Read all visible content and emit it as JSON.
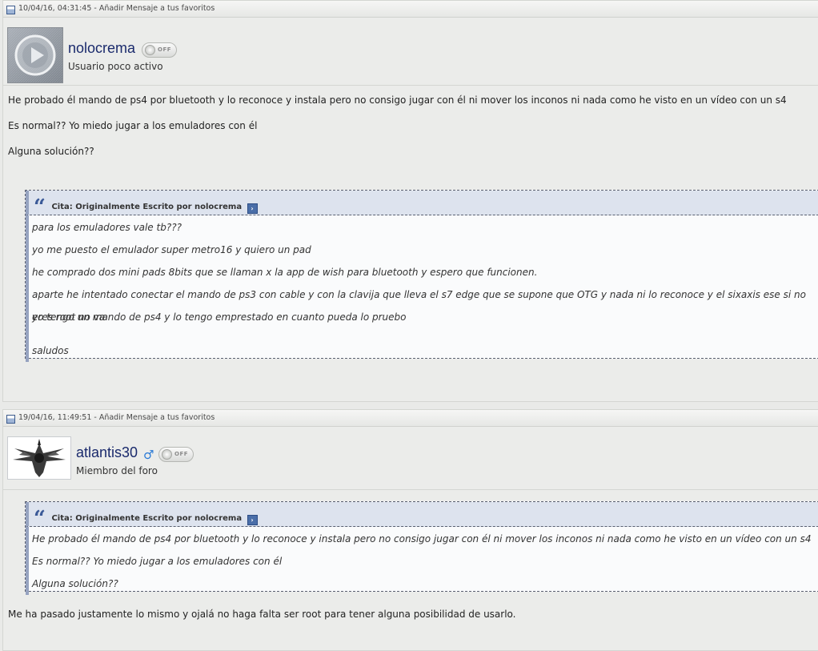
{
  "posts": [
    {
      "header": "10/04/16, 04:31:45 - Añadir Mensaje a tus favoritos",
      "username": "nolocrema",
      "user_title": "Usuario poco activo",
      "status": "OFF",
      "message": [
        "He probado él mando de ps4 por bluetooth y lo reconoce y instala pero no consigo jugar con él ni mover los inconos ni nada como he visto en un vídeo con un s4",
        "Es normal?? Yo miedo jugar a los emuladores con él",
        "Alguna solución??"
      ],
      "quote": {
        "label": "Cita: Originalmente Escrito por nolocrema",
        "lines": [
          "para los emuladores vale tb???",
          "yo me puesto el emulador super metro16 y quiero un pad",
          "he comprado dos mini pads 8bits que se llaman x la app de wish para bluetooth y espero que funcionen.",
          "aparte he intentado conectar el mando de ps3 con cable y con la clavija que lleva el s7 edge que se supone que OTG y nada ni lo reconoce y el sixaxis ese si no eres root no va",
          "yo tengo un mando de ps4 y lo tengo emprestado en cuanto pueda lo pruebo",
          "",
          "saludos"
        ]
      }
    },
    {
      "header": "19/04/16, 11:49:51 - Añadir Mensaje a tus favoritos",
      "username": "atlantis30",
      "user_title": "Miembro del foro",
      "status": "OFF",
      "gender_icon": "male-icon",
      "quote": {
        "label": "Cita: Originalmente Escrito por nolocrema",
        "lines": [
          "He probado él mando de ps4 por bluetooth y lo reconoce y instala pero no consigo jugar con él ni mover los inconos ni nada como he visto en un vídeo con un s4",
          "Es normal?? Yo miedo jugar a los emuladores con él",
          "Alguna solución??"
        ]
      },
      "message": [
        "Me ha pasado justamente lo mismo y ojalá no haga falta ser root para tener alguna posibilidad de usarlo."
      ]
    }
  ],
  "colors": {
    "username": "#1a2a6c",
    "quote_header_bg": "#dde3ee",
    "quote_accent": "#96a3c0"
  }
}
